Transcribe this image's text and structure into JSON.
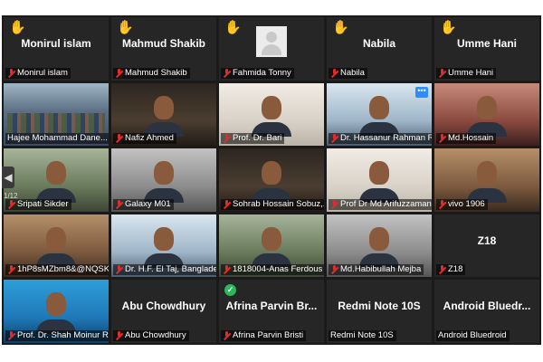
{
  "grid": {
    "tiles": [
      {
        "center_name": "Monirul islam",
        "label": "Monirul islam",
        "hand": true,
        "muted": true,
        "type": "name"
      },
      {
        "center_name": "Mahmud Shakib",
        "label": "Mahmud Shakib",
        "hand": true,
        "muted": true,
        "type": "name"
      },
      {
        "center_name": "",
        "label": "Fahmida Tonny",
        "hand": true,
        "muted": true,
        "type": "avatar"
      },
      {
        "center_name": "Nabila",
        "label": "Nabila",
        "hand": true,
        "muted": true,
        "type": "name"
      },
      {
        "center_name": "Umme Hani",
        "label": "Umme Hani",
        "hand": true,
        "muted": true,
        "type": "name"
      },
      {
        "label": "Hajee Mohammad Dane...",
        "muted": false,
        "type": "video",
        "video": "room",
        "active": true
      },
      {
        "label": "Nafiz Ahmed",
        "muted": true,
        "type": "video",
        "video": "dark"
      },
      {
        "label": "Prof. Dr. Bari",
        "muted": true,
        "type": "video",
        "video": "light"
      },
      {
        "label": "Dr. Hassanur Rahman R...",
        "muted": true,
        "type": "video",
        "video": "blue",
        "menu": true
      },
      {
        "label": "Md.Hossain",
        "muted": true,
        "type": "video",
        "video": "pink"
      },
      {
        "label": "Sripati Sikder",
        "muted": true,
        "type": "video",
        "video": "green"
      },
      {
        "label": "Galaxy M01",
        "muted": true,
        "type": "video",
        "video": "grey"
      },
      {
        "label": "Sohrab Hossain Sobuz,...",
        "muted": true,
        "type": "video",
        "video": "dark"
      },
      {
        "label": "Prof Dr Md Arifuzzaman",
        "muted": true,
        "type": "video",
        "video": "light"
      },
      {
        "label": "vivo 1906",
        "muted": true,
        "type": "video",
        "video": "warm"
      },
      {
        "label": "1hP8sMZbm8&@NQSK_...",
        "muted": true,
        "type": "video",
        "video": "warm"
      },
      {
        "label": "Dr. H.F. El Taj, Bangladesh",
        "muted": true,
        "type": "video",
        "video": "blue"
      },
      {
        "label": "1818004-Anas Ferdous",
        "muted": true,
        "type": "video",
        "video": "green"
      },
      {
        "label": "Md.Habibullah Mejba",
        "muted": true,
        "type": "video",
        "video": "grey"
      },
      {
        "center_name": "Z18",
        "label": "Z18",
        "muted": true,
        "type": "name"
      },
      {
        "label": "Prof. Dr. Shah Moinur R...",
        "muted": true,
        "type": "video",
        "video": "blue2"
      },
      {
        "center_name": "Abu Chowdhury",
        "label": "Abu Chowdhury",
        "muted": true,
        "type": "name"
      },
      {
        "center_name": "Afrina Parvin Br...",
        "label": "Afrina Parvin Bristi",
        "muted": true,
        "type": "name",
        "check": true
      },
      {
        "center_name": "Redmi Note 10S",
        "label": "Redmi Note 10S",
        "muted": false,
        "type": "name"
      },
      {
        "center_name": "Android  Bluedr...",
        "label": "Android Bluedroid",
        "muted": false,
        "type": "name"
      }
    ]
  },
  "pagination": {
    "indicator": "1/12",
    "prev_glyph": "◀"
  },
  "icons": {
    "hand": "✋",
    "check": "✓",
    "menu": "•••"
  }
}
